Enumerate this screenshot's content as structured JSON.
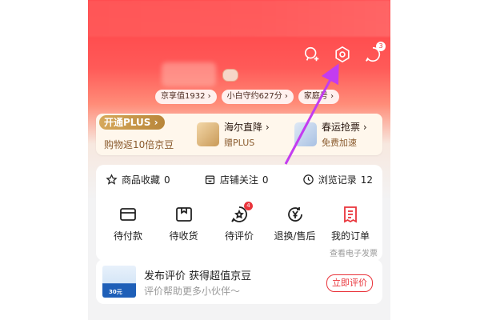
{
  "header": {
    "message_badge": "3",
    "chips": [
      "京享值1932 ›",
      "小白守约627分 ›",
      "家庭号 ›"
    ]
  },
  "plus_card": {
    "tag": "开通PLUS ›",
    "subtitle": "购物返10倍京豆",
    "promos": [
      {
        "title": "海尔直降 ›",
        "sub": "赠PLUS"
      },
      {
        "title": "春运抢票 ›",
        "sub": "免费加速"
      }
    ]
  },
  "stats": [
    {
      "label": "商品收藏",
      "count": "0"
    },
    {
      "label": "店铺关注",
      "count": "0"
    },
    {
      "label": "浏览记录",
      "count": "12"
    }
  ],
  "orders": [
    {
      "label": "待付款"
    },
    {
      "label": "待收货"
    },
    {
      "label": "待评价",
      "badge": "4"
    },
    {
      "label": "退换/售后"
    },
    {
      "label": "我的订单"
    }
  ],
  "orders_sub": "查看电子发票",
  "review": {
    "title": "发布评价 获得超值京豆",
    "sub": "评价帮助更多小伙伴～",
    "button": "立即评价",
    "image_amount": "30元"
  },
  "colors": {
    "brand_red": "#e9343b",
    "header_red": "#ff4a4e",
    "plus_gold": "#c89448",
    "annotation_purple": "#c33cf0"
  }
}
